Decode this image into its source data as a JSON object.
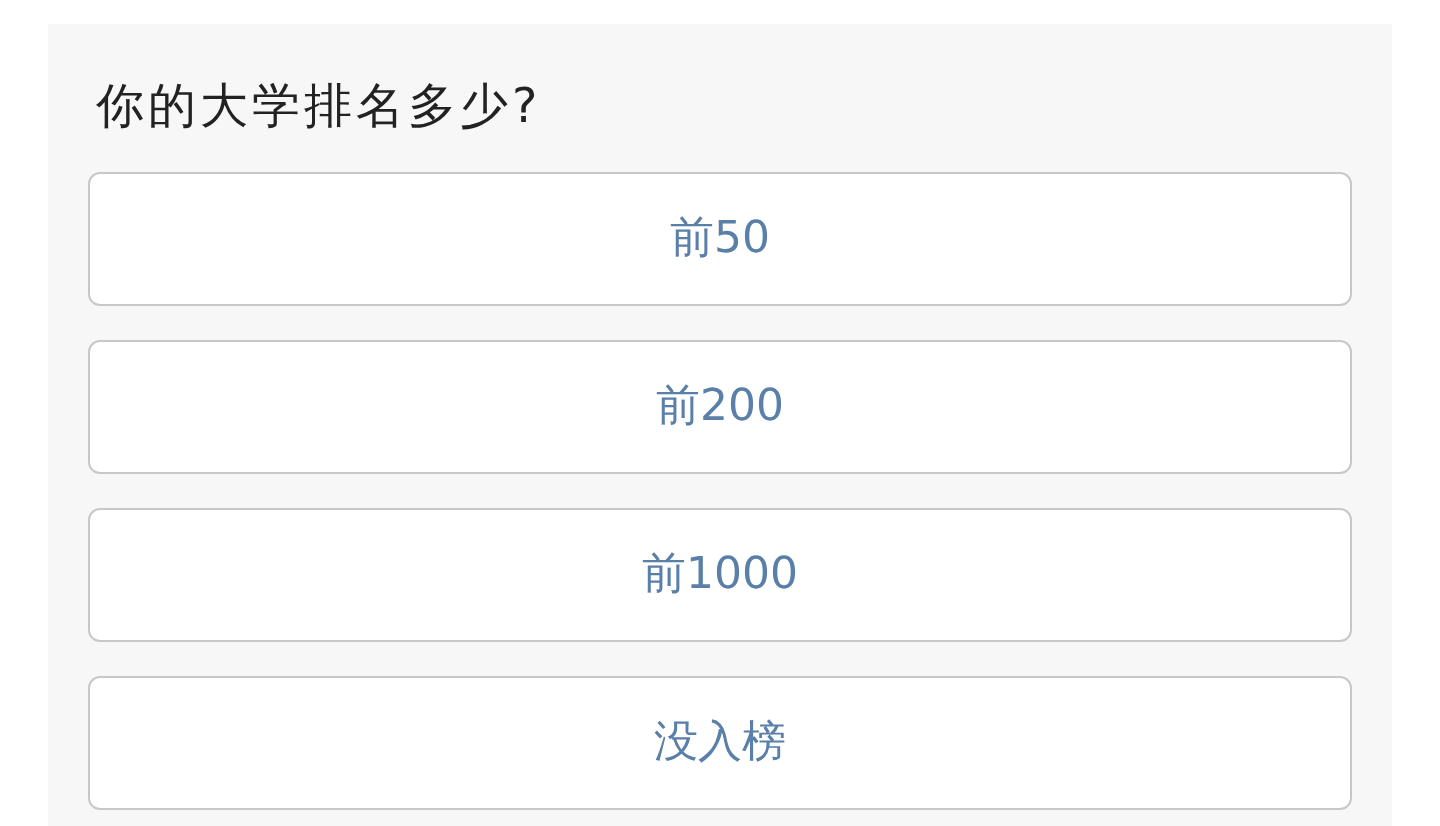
{
  "question": "你的大学排名多少?",
  "options": [
    {
      "label": "前50"
    },
    {
      "label": "前200"
    },
    {
      "label": "前1000"
    },
    {
      "label": "没入榜"
    }
  ]
}
